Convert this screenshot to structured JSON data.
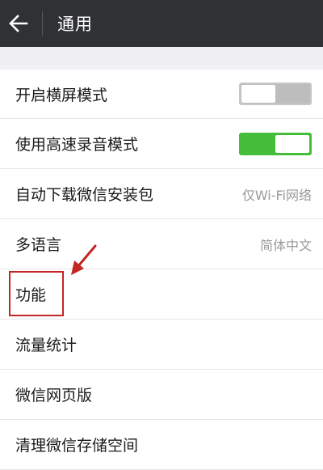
{
  "header": {
    "title": "通用",
    "back_icon": "arrow-left-icon"
  },
  "settings": {
    "items": [
      {
        "label": "开启横屏模式",
        "type": "toggle",
        "state": "off"
      },
      {
        "label": "使用高速录音模式",
        "type": "toggle",
        "state": "on"
      },
      {
        "label": "自动下载微信安装包",
        "type": "value",
        "value": "仅Wi-Fi网络"
      },
      {
        "label": "多语言",
        "type": "value",
        "value": "简体中文"
      },
      {
        "label": "功能",
        "type": "nav"
      },
      {
        "label": "流量统计",
        "type": "nav"
      },
      {
        "label": "微信网页版",
        "type": "nav"
      },
      {
        "label": "清理微信存储空间",
        "type": "nav"
      }
    ]
  },
  "colors": {
    "topbar": "#2f3134",
    "toggle_on": "#44be3a",
    "toggle_off": "#bdbdbd",
    "annotation": "#c42525"
  }
}
